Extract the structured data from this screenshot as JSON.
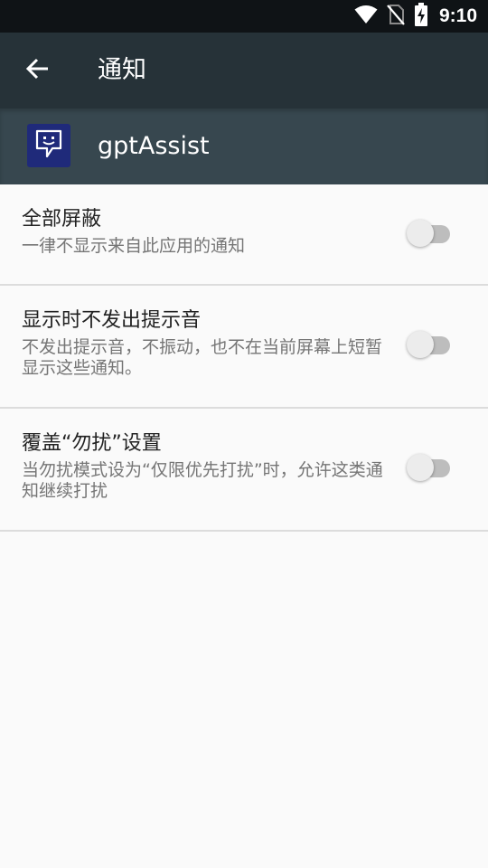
{
  "status_bar": {
    "time": "9:10",
    "icons": [
      "wifi-icon",
      "no-sim-icon",
      "battery-charging-icon"
    ]
  },
  "toolbar": {
    "title": "通知",
    "back_icon": "arrow-back-icon"
  },
  "app": {
    "name": "gptAssist",
    "icon": "chat-bubble-smile-icon",
    "icon_color": "#1f2a7a"
  },
  "settings": [
    {
      "title": "全部屏蔽",
      "summary": "一律不显示来自此应用的通知",
      "enabled": false
    },
    {
      "title": "显示时不发出提示音",
      "summary": "不发出提示音，不振动，也不在当前屏幕上短暂显示这些通知。",
      "enabled": false
    },
    {
      "title": "覆盖“勿扰”设置",
      "summary": "当勿扰模式设为“仅限优先打扰”时，允许这类通知继续打扰",
      "enabled": false
    }
  ],
  "colors": {
    "status_bar": "#0f1316",
    "toolbar": "#263238",
    "app_header": "#37474f",
    "background": "#fafafa"
  }
}
